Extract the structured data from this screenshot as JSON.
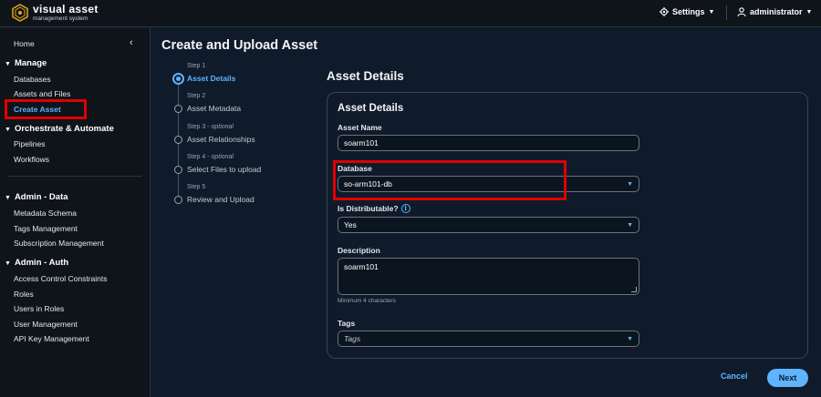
{
  "brand": {
    "title": "visual asset",
    "subtitle": "management system"
  },
  "topbar": {
    "settings_label": "Settings",
    "user_label": "administrator"
  },
  "sidebar": {
    "home": "Home",
    "sections": [
      {
        "title": "Manage",
        "items": [
          "Databases",
          "Assets and Files",
          "Create Asset"
        ]
      },
      {
        "title": "Orchestrate & Automate",
        "items": [
          "Pipelines",
          "Workflows"
        ]
      },
      {
        "title": "Admin - Data",
        "items": [
          "Metadata Schema",
          "Tags Management",
          "Subscription Management"
        ]
      },
      {
        "title": "Admin - Auth",
        "items": [
          "Access Control Constraints",
          "Roles",
          "Users in Roles",
          "User Management",
          "API Key Management"
        ]
      }
    ],
    "active_item": "Create Asset"
  },
  "page_title": "Create and Upload Asset",
  "steps": [
    {
      "label": "Step 1",
      "optional": "",
      "title": "Asset Details"
    },
    {
      "label": "Step 2",
      "optional": "",
      "title": "Asset Metadata"
    },
    {
      "label": "Step 3 - ",
      "optional": "optional",
      "title": "Asset Relationships"
    },
    {
      "label": "Step 4 - ",
      "optional": "optional",
      "title": "Select Files to upload"
    },
    {
      "label": "Step 5",
      "optional": "",
      "title": "Review and Upload"
    }
  ],
  "form": {
    "section_heading": "Asset Details",
    "panel_title": "Asset Details",
    "asset_name": {
      "label": "Asset Name",
      "value": "soarm101"
    },
    "database": {
      "label": "Database",
      "value": "so-arm101-db"
    },
    "distributable": {
      "label": "Is Distributable?",
      "value": "Yes"
    },
    "description": {
      "label": "Description",
      "value": "soarm101",
      "hint": "Minimum 4 characters"
    },
    "tags": {
      "label": "Tags",
      "placeholder": "Tags"
    }
  },
  "footer": {
    "cancel_label": "Cancel",
    "next_label": "Next"
  },
  "colors": {
    "accent": "#5fb3ff",
    "highlight": "#e00000",
    "background": "#0f1b2a",
    "sidebar": "#0f141a"
  }
}
